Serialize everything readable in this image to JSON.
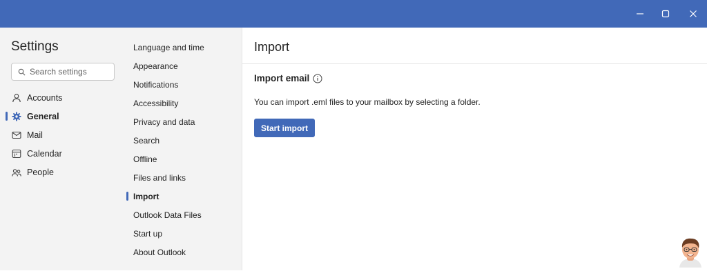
{
  "window": {
    "controls": [
      "minimize",
      "maximize",
      "close"
    ],
    "colors": {
      "titlebar": "#4169b8",
      "accent": "#4169b8"
    }
  },
  "sidebar": {
    "title": "Settings",
    "search_placeholder": "Search settings",
    "items": [
      {
        "label": "Accounts",
        "icon": "person-icon",
        "active": false
      },
      {
        "label": "General",
        "icon": "gear-icon",
        "active": true
      },
      {
        "label": "Mail",
        "icon": "mail-icon",
        "active": false
      },
      {
        "label": "Calendar",
        "icon": "calendar-icon",
        "active": false
      },
      {
        "label": "People",
        "icon": "people-icon",
        "active": false
      }
    ]
  },
  "subnav": {
    "items": [
      {
        "label": "Language and time",
        "active": false
      },
      {
        "label": "Appearance",
        "active": false
      },
      {
        "label": "Notifications",
        "active": false
      },
      {
        "label": "Accessibility",
        "active": false
      },
      {
        "label": "Privacy and data",
        "active": false
      },
      {
        "label": "Search",
        "active": false
      },
      {
        "label": "Offline",
        "active": false
      },
      {
        "label": "Files and links",
        "active": false
      },
      {
        "label": "Import",
        "active": true
      },
      {
        "label": "Outlook Data Files",
        "active": false
      },
      {
        "label": "Start up",
        "active": false
      },
      {
        "label": "About Outlook",
        "active": false
      }
    ]
  },
  "main": {
    "title": "Import",
    "section_title": "Import email",
    "description": "You can import .eml files to your mailbox by selecting a folder.",
    "primary_button": "Start import"
  }
}
